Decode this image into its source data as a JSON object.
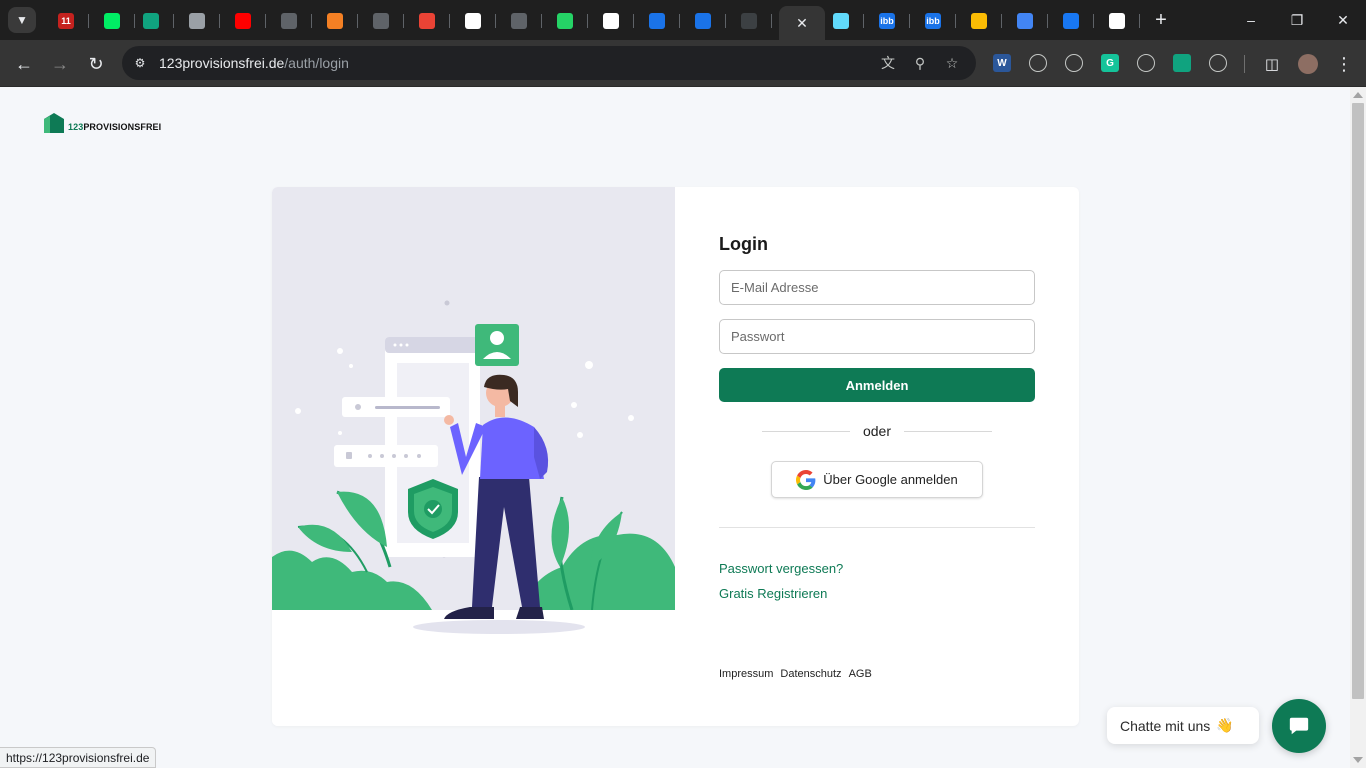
{
  "browser": {
    "tabs": [
      {
        "icon": "calendar-badge-icon",
        "color": "#c5221f",
        "badge": "11"
      },
      {
        "icon": "mongodb-leaf-icon",
        "color": "#00ed64"
      },
      {
        "icon": "openai-icon",
        "color": "#10a37f"
      },
      {
        "icon": "globe-icon",
        "color": "#9aa0a6"
      },
      {
        "icon": "youtube-icon",
        "color": "#ff0000"
      },
      {
        "icon": "github-icon",
        "color": "#5f6368"
      },
      {
        "icon": "stackoverflow-icon",
        "color": "#f48024"
      },
      {
        "icon": "github-icon",
        "color": "#5f6368"
      },
      {
        "icon": "gmail-icon",
        "color": "#ea4335"
      },
      {
        "icon": "google-icon",
        "color": "#ffffff"
      },
      {
        "icon": "github-icon",
        "color": "#5f6368"
      },
      {
        "icon": "whatsapp-icon",
        "color": "#25d366"
      },
      {
        "icon": "medium-icon",
        "color": "#ffffff"
      },
      {
        "icon": "media-player-icon",
        "color": "#1a73e8"
      },
      {
        "icon": "user-app-icon",
        "color": "#1a73e8"
      },
      {
        "icon": "dark-site-icon",
        "color": "#3c4043"
      },
      {
        "icon": "active-tab-close-icon",
        "color": "#353535",
        "active": true
      },
      {
        "icon": "react-icon",
        "color": "#61dafb"
      },
      {
        "icon": "ibb-icon",
        "color": "#1a73e8",
        "label": "ibb"
      },
      {
        "icon": "ibb-icon",
        "color": "#1a73e8",
        "label": "ibb"
      },
      {
        "icon": "google-drive-icon",
        "color": "#fbbc04"
      },
      {
        "icon": "google-docs-icon",
        "color": "#4285f4"
      },
      {
        "icon": "facebook-icon",
        "color": "#1877f2"
      },
      {
        "icon": "chrome-icon",
        "color": "#ffffff"
      }
    ],
    "url_domain": "123provisionsfrei.de",
    "url_path": "/auth/login",
    "extensions": [
      {
        "icon": "word-icon",
        "color": "#2b579a",
        "label": "W"
      },
      {
        "icon": "react-devtools-icon",
        "color": "#353535"
      },
      {
        "icon": "target-icon",
        "color": "#353535"
      },
      {
        "icon": "grammarly-icon",
        "color": "#15c39a",
        "label": "G"
      },
      {
        "icon": "camera-icon",
        "color": "#353535"
      },
      {
        "icon": "chatgpt-ext-icon",
        "color": "#10a37f"
      },
      {
        "icon": "puzzle-icon",
        "color": "#353535"
      }
    ],
    "status_url": "https://123provisionsfrei.de"
  },
  "logo": {
    "number": "123",
    "word": "PROVISIONSFREI"
  },
  "login": {
    "title": "Login",
    "email_placeholder": "E-Mail Adresse",
    "password_placeholder": "Passwort",
    "submit_label": "Anmelden",
    "or_label": "oder",
    "google_label": "Über Google anmelden",
    "forgot_label": "Passwort vergessen?",
    "register_label": "Gratis Registrieren"
  },
  "footer": {
    "impressum": "Impressum",
    "datenschutz": "Datenschutz",
    "agb": "AGB"
  },
  "chat": {
    "bubble_text": "Chatte mit uns",
    "emoji": "👋"
  },
  "colors": {
    "brand_green": "#0e7a55",
    "illustration_green": "#3fb97a",
    "person_shirt": "#6c63ff",
    "person_pants": "#2f2e6e",
    "illustration_bg": "#e8e8f0"
  }
}
